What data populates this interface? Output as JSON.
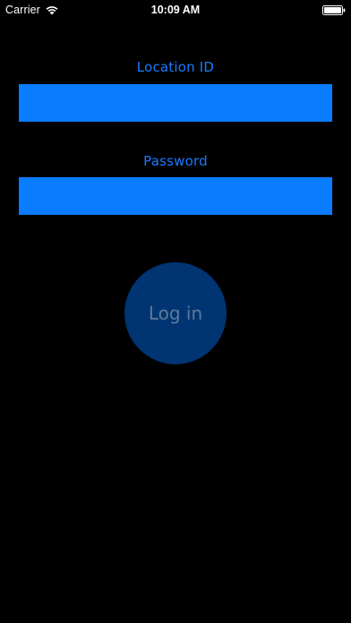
{
  "status_bar": {
    "carrier": "Carrier",
    "time": "10:09 AM",
    "wifi_icon": "wifi-icon",
    "battery_icon": "battery-full-icon"
  },
  "form": {
    "location_label": "Location ID",
    "location_value": "",
    "password_label": "Password",
    "password_value": "",
    "login_label": "Log in"
  },
  "colors": {
    "background": "#000000",
    "accent": "#1a7bff",
    "field_fill": "#0a7cff",
    "button_fill": "#003472",
    "button_text": "#5f7a99"
  }
}
